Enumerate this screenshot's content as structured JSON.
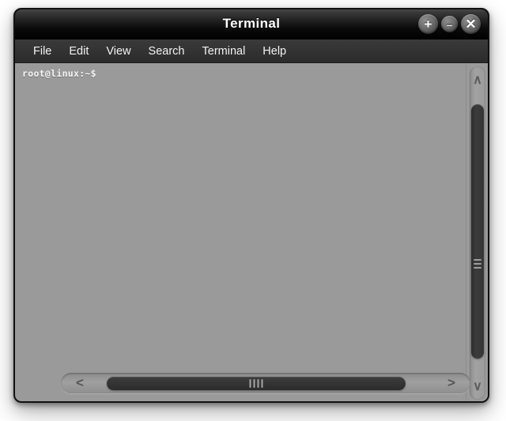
{
  "window": {
    "title": "Terminal",
    "colors": {
      "titlebar_top": "#4a4a4a",
      "titlebar_bottom": "#000000",
      "menubar": "#333333",
      "terminal_bg": "#9a9a9a",
      "terminal_fg": "#f4f4f4",
      "scroll_thumb": "#353535",
      "scroll_trough": "#9b9b9b",
      "border": "#111111"
    },
    "controls": [
      {
        "name": "maximize",
        "glyph": "+"
      },
      {
        "name": "minimize",
        "glyph": "–"
      },
      {
        "name": "close",
        "glyph": "✕"
      }
    ]
  },
  "menubar": {
    "items": [
      {
        "label": "File"
      },
      {
        "label": "Edit"
      },
      {
        "label": "View"
      },
      {
        "label": "Search"
      },
      {
        "label": "Terminal"
      },
      {
        "label": "Help"
      }
    ]
  },
  "terminal": {
    "lines": [
      "root@linux:~$"
    ],
    "prompt": "root@linux:~$",
    "user": "root",
    "host": "linux",
    "cwd": "~"
  },
  "scrollbars": {
    "vertical": {
      "up_arrow": "∧",
      "down_arrow": "∨",
      "grip_count": 3
    },
    "horizontal": {
      "left_arrow": "<",
      "right_arrow": ">",
      "grip_count": 4
    }
  }
}
